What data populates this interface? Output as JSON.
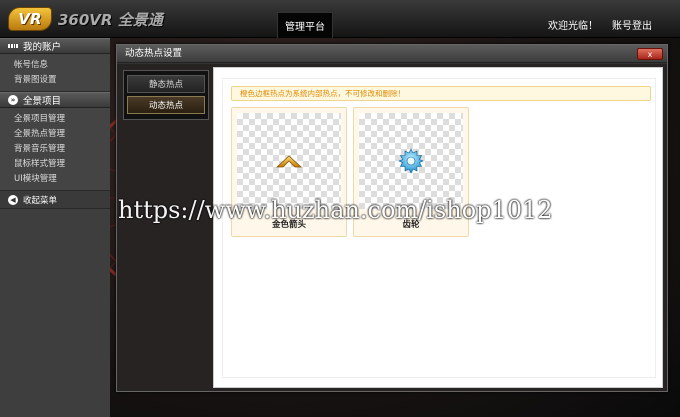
{
  "header": {
    "logo_badge": "VR",
    "logo_text": "360VR 全景通",
    "nav_tab": "管理平台",
    "welcome": "欢迎光临！",
    "logout": "账号登出"
  },
  "sidebar": {
    "sections": [
      {
        "title": "我的账户",
        "icon": "grid-icon",
        "items": [
          "帐号信息",
          "背景图设置"
        ]
      },
      {
        "title": "全景项目",
        "icon": "arrow-icon",
        "items": [
          "全景项目管理",
          "全景热点管理",
          "背景音乐管理",
          "鼠标样式管理",
          "UI模块管理"
        ]
      }
    ],
    "collapse_label": "收起菜单"
  },
  "dialog": {
    "title": "动态热点设置",
    "close_label": "x",
    "tabs": [
      {
        "label": "静态热点",
        "active": false
      },
      {
        "label": "动态热点",
        "active": true
      }
    ],
    "notice": "橙色边框热点为系统内部热点，不可修改和删除！",
    "hotspots": [
      {
        "name": "金色箭头",
        "icon": "gold-arrow-icon"
      },
      {
        "name": "齿轮",
        "icon": "gear-icon"
      }
    ]
  },
  "watermark": "https://www.huzhan.com/ishop1012",
  "colors": {
    "notice_text": "#e08a00",
    "card_border": "#f0d8a8",
    "close_button": "#c0392b"
  }
}
